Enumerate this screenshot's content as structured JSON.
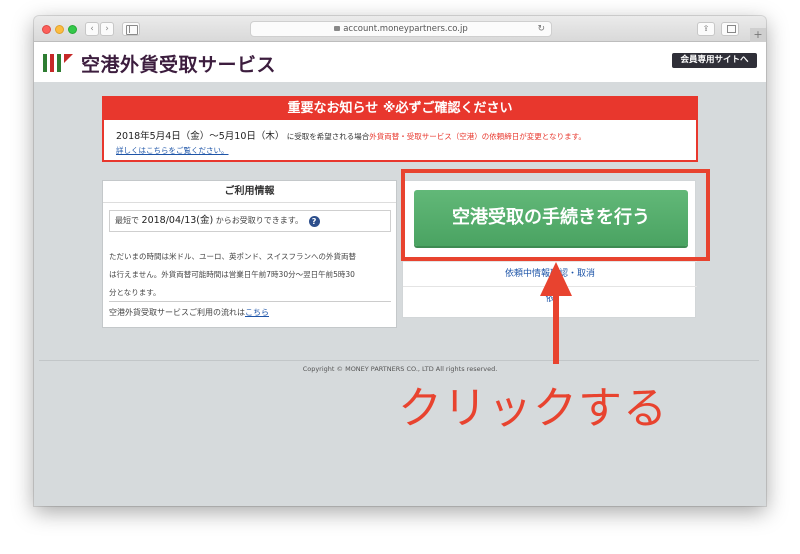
{
  "browser": {
    "url": "account.moneypartners.co.jp"
  },
  "header": {
    "logo_text": "空港外貨受取サービス",
    "logo_colors": [
      "#2e7d32",
      "#c62828",
      "#2e7d32",
      "#c62828"
    ],
    "member_site_button": "会員専用サイトへ"
  },
  "notice": {
    "title": "重要なお知らせ ※必ずご確認ください",
    "date_range": "2018年5月4日（金）〜5月10日（木）",
    "body_part1": "に受取を希望される場合",
    "body_highlight": "外貨両替・受取サービス（空港）の依頼締日が変更となります。",
    "details_link": "詳しくはこちらをご覧ください。"
  },
  "info": {
    "title": "ご利用情報",
    "earliest_prefix": "最短で",
    "earliest_date": "2018/04/13(金)",
    "earliest_suffix": "からお受取りできます。",
    "help_icon": "?",
    "hours_lines": [
      "ただいまの時間は米ドル、ユーロ、英ポンド、スイスフランへの外貨両替",
      "は行えません。外貨両替可能時間は営業日午前7時30分〜翌日午前5時30",
      "分となります。"
    ],
    "flow_text": "空港外貨受取サービスご利用の流れは",
    "flow_link": "こちら"
  },
  "actions": {
    "main_button": "空港受取の手続きを行う",
    "row1": "依頼中情報確認・取消",
    "row2": "依"
  },
  "footer": {
    "copyright": "Copyright © MONEY PARTNERS CO., LTD All rights reserved."
  },
  "annotation": {
    "label": "クリックする",
    "color": "#e8432f"
  }
}
